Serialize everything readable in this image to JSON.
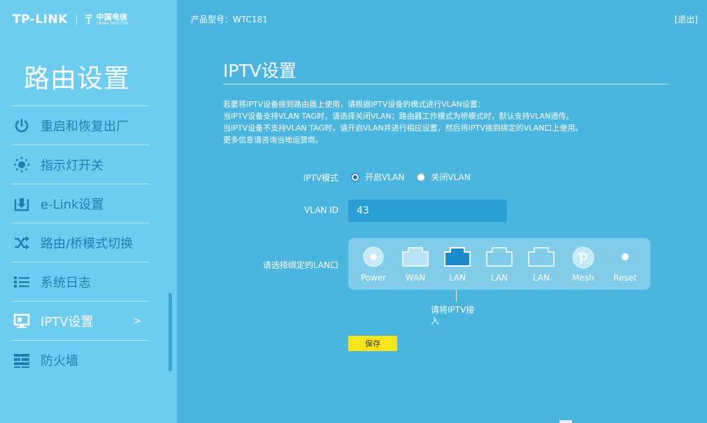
{
  "brand": {
    "name": "TP-LINK",
    "partner_cn": "中国电信",
    "partner_en": "CHINA TELECOM"
  },
  "header": {
    "model_label": "产品型号：WTC181",
    "logout": "[退出]"
  },
  "sidebar": {
    "title": "路由设置",
    "items": [
      {
        "label": "重启和恢复出厂",
        "icon": "power-icon"
      },
      {
        "label": "指示灯开关",
        "icon": "led-light-icon"
      },
      {
        "label": "e-Link设置",
        "icon": "download-tray-icon"
      },
      {
        "label": "路由/桥模式切换",
        "icon": "shuffle-icon"
      },
      {
        "label": "系统日志",
        "icon": "list-icon"
      },
      {
        "label": "IPTV设置",
        "icon": "monitor-icon",
        "active": true,
        "arrow": ">"
      },
      {
        "label": "防火墙",
        "icon": "firewall-icon"
      }
    ]
  },
  "main": {
    "title": "IPTV设置",
    "description": [
      "若要将IPTV设备接到路由器上使用，请根据IPTV设备的模式进行VLAN设置：",
      "当IPTV设备支持VLAN TAG时，请选择关闭VLAN；路由器工作模式为桥模式时，默认支持VLAN透传。",
      "当IPTV设备不支持VLAN TAG时，请开启VLAN并进行相应设置，然后将IPTV接到绑定的VLAN口上使用。",
      "更多信息请咨询当地运营商。"
    ],
    "iptv_mode": {
      "label": "IPTV模式",
      "options": [
        {
          "label": "开启VLAN",
          "checked": true
        },
        {
          "label": "关闭VLAN",
          "checked": false
        }
      ]
    },
    "vlan_id": {
      "label": "VLAN ID",
      "value": "43"
    },
    "lan_bind": {
      "label": "请选择绑定的LAN口",
      "ports": [
        {
          "label": "Power",
          "icon": "power-led-icon"
        },
        {
          "label": "WAN",
          "icon": "wan-port-icon"
        },
        {
          "label": "LAN",
          "icon": "lan-port-icon",
          "selected": true
        },
        {
          "label": "LAN",
          "icon": "lan-port-icon"
        },
        {
          "label": "LAN",
          "icon": "lan-port-icon"
        },
        {
          "label": "Mesh",
          "icon": "mesh-button-icon"
        },
        {
          "label": "Reset",
          "icon": "reset-button-icon"
        }
      ],
      "hint": "请将IPTV接入"
    },
    "save_label": "保存"
  },
  "colors": {
    "background": "#4ab6e0",
    "sidebar": "#6dcdf0",
    "menu_text": "#1f7fb3",
    "input_bg": "#2a9fd6",
    "save_button": "#f6e51a",
    "selected_port": "#1a8ac9"
  }
}
